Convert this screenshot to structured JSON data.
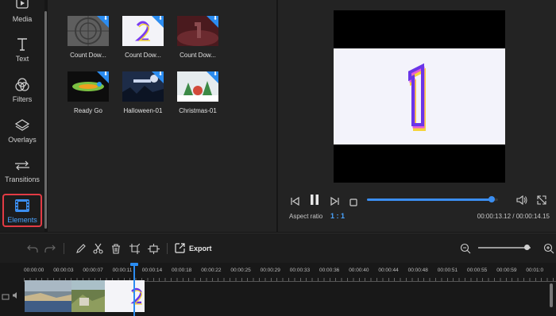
{
  "sidebar": {
    "items": [
      {
        "label": "Media",
        "icon": "media-icon"
      },
      {
        "label": "Text",
        "icon": "text-icon"
      },
      {
        "label": "Filters",
        "icon": "filters-icon"
      },
      {
        "label": "Overlays",
        "icon": "overlays-icon"
      },
      {
        "label": "Transitions",
        "icon": "transitions-icon"
      },
      {
        "label": "Elements",
        "icon": "elements-icon",
        "active": true
      }
    ]
  },
  "elements": [
    {
      "label": "Count Dow..."
    },
    {
      "label": "Count Dow..."
    },
    {
      "label": "Count Dow..."
    },
    {
      "label": "Ready Go"
    },
    {
      "label": "Halloween-01"
    },
    {
      "label": "Christmas-01"
    }
  ],
  "preview": {
    "aspect_label": "Aspect ratio",
    "aspect_value": "1 : 1",
    "time": "00:00:13.12 / 00:00:14.15",
    "progress": 0.95
  },
  "toolbar": {
    "export_label": "Export",
    "zoom_level": 0.92
  },
  "timeline": {
    "ticks": [
      "00:00:00",
      "00:00:03",
      "00:00:07",
      "00:00:11",
      "00:00:14",
      "00:00:18",
      "00:00:22",
      "00:00:25",
      "00:00:29",
      "00:00:33",
      "00:00:36",
      "00:00:40",
      "00:00:44",
      "00:00:48",
      "00:00:51",
      "00:00:55",
      "00:00:59",
      "00:01:0"
    ]
  },
  "colors": {
    "accent": "#2b8cf0",
    "active_border": "#e23b44",
    "active_label": "#4aa4ff"
  }
}
